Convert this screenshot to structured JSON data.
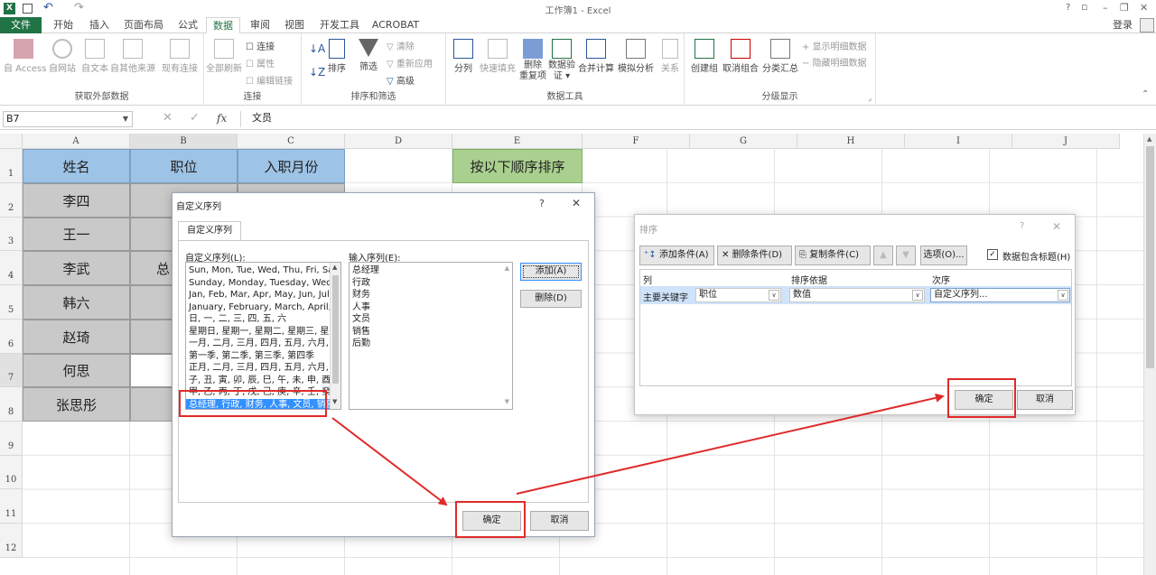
{
  "window": {
    "title": "工作簿1 - Excel",
    "help": "?",
    "restore": "▫",
    "minimize": "–",
    "maximize": "❐",
    "close": "✕",
    "login": "登录"
  },
  "tabs": [
    "文件",
    "开始",
    "插入",
    "页面布局",
    "公式",
    "数据",
    "审阅",
    "视图",
    "开发工具",
    "ACROBAT"
  ],
  "ribbon": {
    "external": {
      "label": "获取外部数据",
      "buttons": [
        "自 Access",
        "自网站",
        "自文本",
        "自其他来源",
        "现有连接"
      ]
    },
    "connections": {
      "label": "连接",
      "refresh": "全部刷新",
      "items": [
        "连接",
        "属性",
        "编辑链接"
      ]
    },
    "sort_filter": {
      "label": "排序和筛选",
      "sort": "排序",
      "filter": "筛选",
      "items": [
        "清除",
        "重新应用",
        "高级"
      ]
    },
    "tools": {
      "label": "数据工具",
      "buttons": [
        "分列",
        "快速填充",
        "删除\n重复项",
        "数据验\n证 ▾",
        "合并计算",
        "模拟分析",
        "关系"
      ]
    },
    "outline": {
      "label": "分级显示",
      "buttons": [
        "创建组",
        "取消组合",
        "分类汇总"
      ],
      "items": [
        "显示明细数据",
        "隐藏明细数据"
      ]
    }
  },
  "formula_bar": {
    "name_box": "B7",
    "fx": "fx",
    "content": "文员"
  },
  "sheet": {
    "columns": [
      "A",
      "B",
      "C",
      "D",
      "E",
      "F",
      "G",
      "H",
      "I",
      "J"
    ],
    "rows": [
      "1",
      "2",
      "3",
      "4",
      "5",
      "6",
      "7",
      "8",
      "9",
      "10",
      "11",
      "12"
    ],
    "headers": {
      "name": "姓名",
      "position": "职位",
      "month": "入职月份",
      "sort_title": "按以下顺序排序"
    },
    "names": [
      "李四",
      "王一",
      "李武",
      "韩六",
      "赵琦",
      "何思",
      "张思彤"
    ],
    "b_visible": [
      "总",
      "",
      ""
    ]
  },
  "custom_list_dialog": {
    "title": "自定义序列",
    "help": "?",
    "close": "✕",
    "tab": "自定义序列",
    "left_label": "自定义序列(L):",
    "right_label": "输入序列(E):",
    "lists": [
      "Sun, Mon, Tue, Wed, Thu, Fri, Sa",
      "Sunday, Monday, Tuesday, Wed",
      "Jan, Feb, Mar, Apr, May, Jun, Jul,",
      "January, February, March, April,",
      "日, 一, 二, 三, 四, 五, 六",
      "星期日, 星期一, 星期二, 星期三, 星期",
      "一月, 二月, 三月, 四月, 五月, 六月, 一",
      "第一季, 第二季, 第三季, 第四季",
      "正月, 二月, 三月, 四月, 五月, 六月, 一",
      "子, 丑, 寅, 卯, 辰, 巳, 午, 未, 申, 酉,",
      "甲, 乙, 丙, 丁, 戊, 己, 庚, 辛, 壬, 癸",
      "总经理, 行政, 财务, 人事, 文员, 销售"
    ],
    "entries": [
      "总经理",
      "行政",
      "财务",
      "人事",
      "文员",
      "销售",
      "后勤"
    ],
    "add": "添加(A)",
    "delete": "删除(D)",
    "ok": "确定",
    "cancel": "取消"
  },
  "sort_dialog": {
    "title": "排序",
    "help": "?",
    "close": "✕",
    "add_level": "添加条件(A)",
    "delete_level": "删除条件(D)",
    "copy_level": "复制条件(C)",
    "options": "选项(O)...",
    "has_headers": "数据包含标题(H)",
    "col_header": "列",
    "sorton_header": "排序依据",
    "order_header": "次序",
    "key_label": "主要关键字",
    "column": "职位",
    "sort_on": "数值",
    "order": "自定义序列...",
    "ok": "确定",
    "cancel": "取消"
  },
  "colors": {
    "excel_green": "#217346",
    "header_blue": "#9dc3e6",
    "cell_gray": "#c9c9c9",
    "e_header_green": "#a9d08e",
    "annotation_red": "#e02a2a",
    "selection_blue": "#3390ff"
  }
}
